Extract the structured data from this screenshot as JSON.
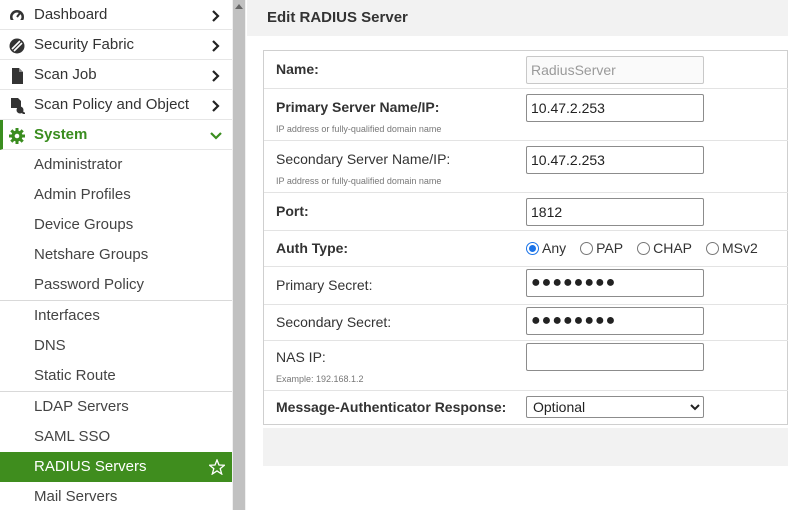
{
  "sidebar": {
    "top_items": [
      {
        "label": "Dashboard",
        "icon": "dashboard-icon"
      },
      {
        "label": "Security Fabric",
        "icon": "security-fabric-icon"
      },
      {
        "label": "Scan Job",
        "icon": "document-icon"
      },
      {
        "label": "Scan Policy and Object",
        "icon": "policy-icon"
      },
      {
        "label": "System",
        "icon": "gear-icon"
      }
    ],
    "sub_items": [
      {
        "label": "Administrator"
      },
      {
        "label": "Admin Profiles"
      },
      {
        "label": "Device Groups"
      },
      {
        "label": "Netshare Groups"
      },
      {
        "label": "Password Policy"
      },
      {
        "label": "Interfaces"
      },
      {
        "label": "DNS"
      },
      {
        "label": "Static Route"
      },
      {
        "label": "LDAP Servers"
      },
      {
        "label": "SAML SSO"
      },
      {
        "label": "RADIUS Servers"
      },
      {
        "label": "Mail Servers"
      }
    ],
    "accent_color": "#3a8d1f"
  },
  "header": {
    "title": "Edit RADIUS Server"
  },
  "form": {
    "name": {
      "label": "Name:",
      "value": "RadiusServer"
    },
    "primary_server": {
      "label": "Primary Server Name/IP:",
      "hint": "IP address or fully-qualified domain name",
      "value": "10.47.2.253"
    },
    "secondary_server": {
      "label": "Secondary Server Name/IP:",
      "hint": "IP address or fully-qualified domain name",
      "value": "10.47.2.253"
    },
    "port": {
      "label": "Port:",
      "value": "1812"
    },
    "auth_type": {
      "label": "Auth Type:",
      "options": [
        "Any",
        "PAP",
        "CHAP",
        "MSv2"
      ],
      "selected": "Any"
    },
    "primary_secret": {
      "label": "Primary Secret:",
      "value": "●●●●●●●●"
    },
    "secondary_secret": {
      "label": "Secondary Secret:",
      "value": "●●●●●●●●"
    },
    "nas_ip": {
      "label": "NAS IP:",
      "hint": "Example: 192.168.1.2",
      "value": ""
    },
    "message_authenticator": {
      "label": "Message-Authenticator Response:",
      "value": "Optional"
    }
  }
}
